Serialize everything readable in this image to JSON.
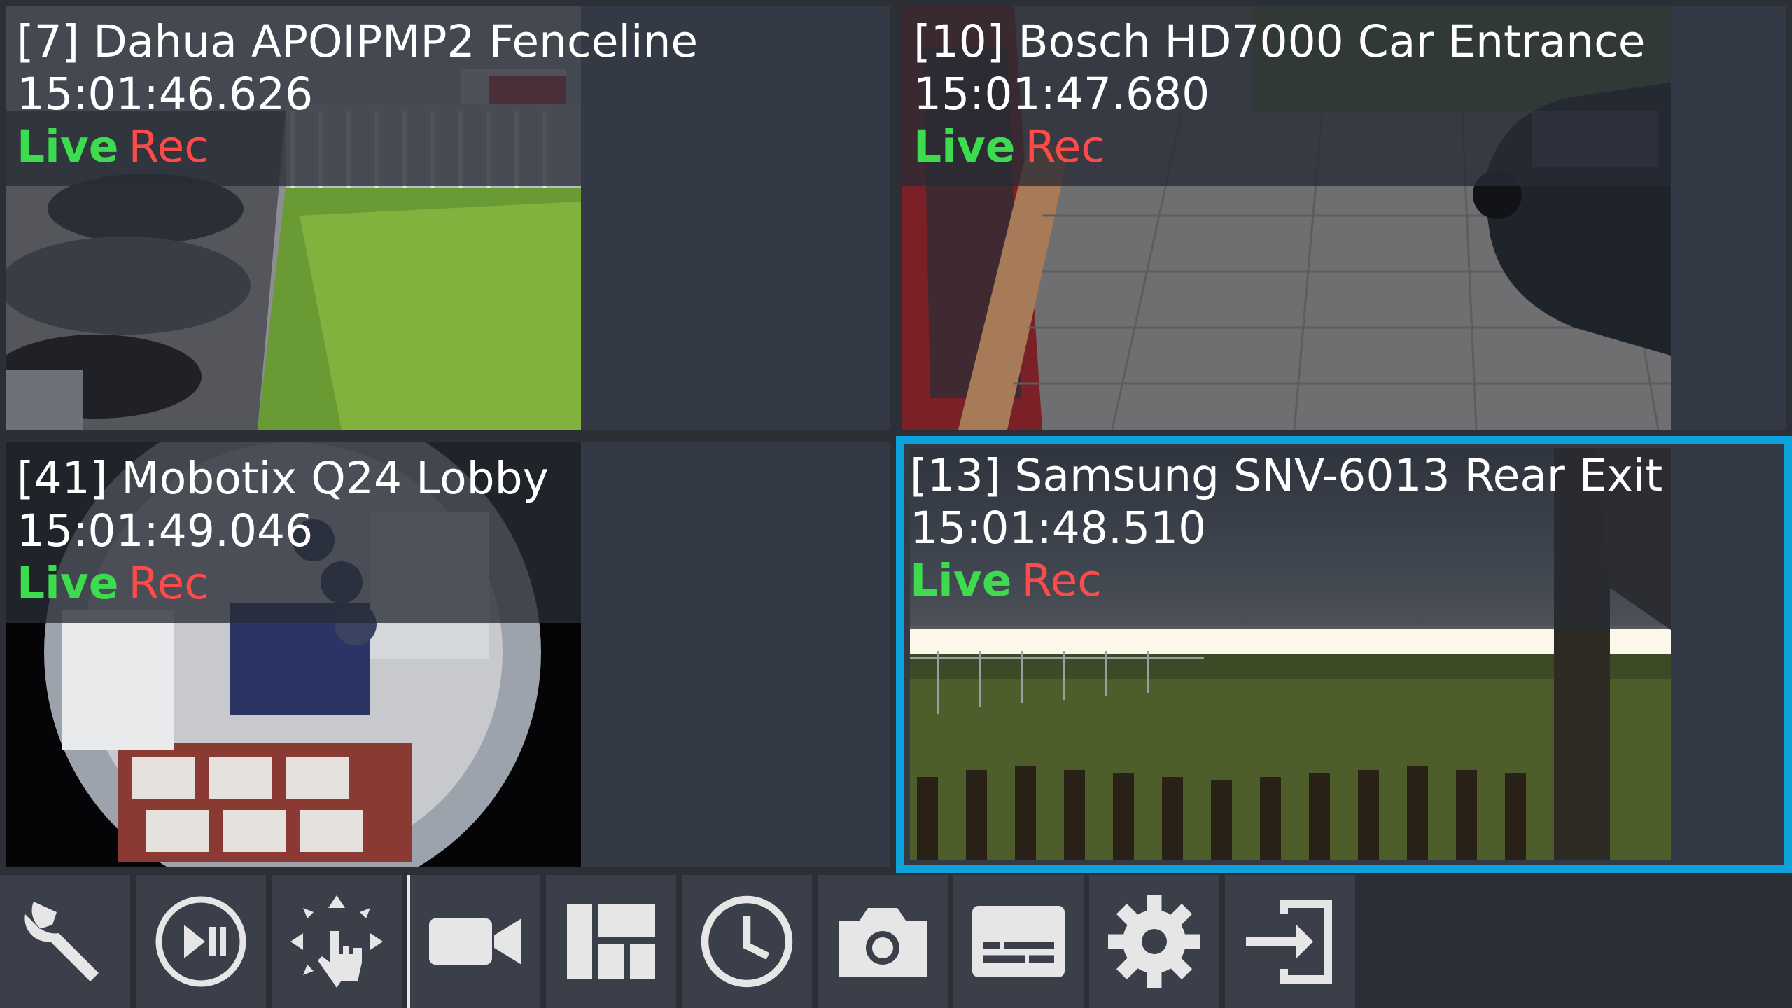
{
  "cameras": [
    {
      "title": "[7] Dahua APOIPMP2 Fenceline",
      "time": "15:01:46.626",
      "live": "Live",
      "rec": "Rec",
      "selected": false
    },
    {
      "title": "[10] Bosch HD7000 Car Entrance",
      "time": "15:01:47.680",
      "live": "Live",
      "rec": "Rec",
      "selected": false
    },
    {
      "title": "[41] Mobotix Q24 Lobby",
      "time": "15:01:49.046",
      "live": "Live",
      "rec": "Rec",
      "selected": false
    },
    {
      "title": "[13] Samsung SNV-6013 Rear Exit",
      "time": "15:01:48.510",
      "live": "Live",
      "rec": "Rec",
      "selected": true
    }
  ],
  "toolbar": [
    {
      "icon": "wrench-icon"
    },
    {
      "icon": "play-pause-icon"
    },
    {
      "icon": "ptz-gesture-icon"
    },
    {
      "icon": "video-camera-icon"
    },
    {
      "icon": "layout-icon"
    },
    {
      "icon": "clock-icon"
    },
    {
      "icon": "camera-snapshot-icon"
    },
    {
      "icon": "subtitles-icon"
    },
    {
      "icon": "gear-icon"
    },
    {
      "icon": "exit-icon"
    }
  ],
  "colors": {
    "selected_border": "#0ea2dc",
    "live": "#3ddc4f",
    "rec": "#ff4a4a",
    "toolbar_button": "#3a3f4a",
    "background": "#2c2f35"
  }
}
